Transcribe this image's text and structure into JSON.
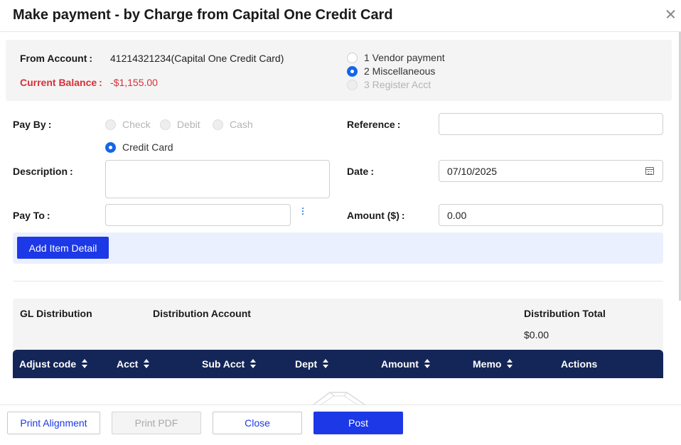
{
  "header": {
    "title": "Make payment - by Charge from Capital One Credit Card"
  },
  "account_info": {
    "from_account_label": "From Account",
    "from_account_value": "41214321234(Capital One Credit Card)",
    "balance_label": "Current Balance",
    "balance_value": "-$1,155.00",
    "payment_types": [
      {
        "label": "1 Vendor payment",
        "state": "unchecked"
      },
      {
        "label": "2 Miscellaneous",
        "state": "checked"
      },
      {
        "label": "3 Register Acct",
        "state": "disabled"
      }
    ]
  },
  "form": {
    "pay_by_label": "Pay By",
    "pay_by_options": [
      {
        "label": "Check",
        "state": "disabled"
      },
      {
        "label": "Debit",
        "state": "disabled"
      },
      {
        "label": "Cash",
        "state": "disabled"
      },
      {
        "label": "Credit Card",
        "state": "checked"
      }
    ],
    "reference_label": "Reference",
    "reference_value": "",
    "description_label": "Description",
    "description_value": "",
    "date_label": "Date",
    "date_value": "07/10/2025",
    "pay_to_label": "Pay To",
    "pay_to_value": "",
    "amount_label": "Amount ($)",
    "amount_value": "0.00",
    "label_colon": ":",
    "add_item_label": "Add Item Detail"
  },
  "gl": {
    "title": "GL Distribution",
    "account_header": "Distribution Account",
    "total_header": "Distribution Total",
    "total_value": "$0.00"
  },
  "table": {
    "columns": [
      "Adjust code",
      "Acct",
      "Sub Acct",
      "Dept",
      "Amount",
      "Memo",
      "Actions"
    ]
  },
  "footer": {
    "print_alignment": "Print Alignment",
    "print_pdf": "Print PDF",
    "close": "Close",
    "post": "Post"
  },
  "icons": {
    "close": "close-icon",
    "calendar": "calendar-icon",
    "more": "more-vertical-icon",
    "sort": "sort-icon"
  },
  "colors": {
    "primary": "#1d38e6",
    "table_header": "#142657",
    "negative": "#d9303a",
    "radio_checked": "#1565e8",
    "detail_bar": "#eaf0fe"
  }
}
